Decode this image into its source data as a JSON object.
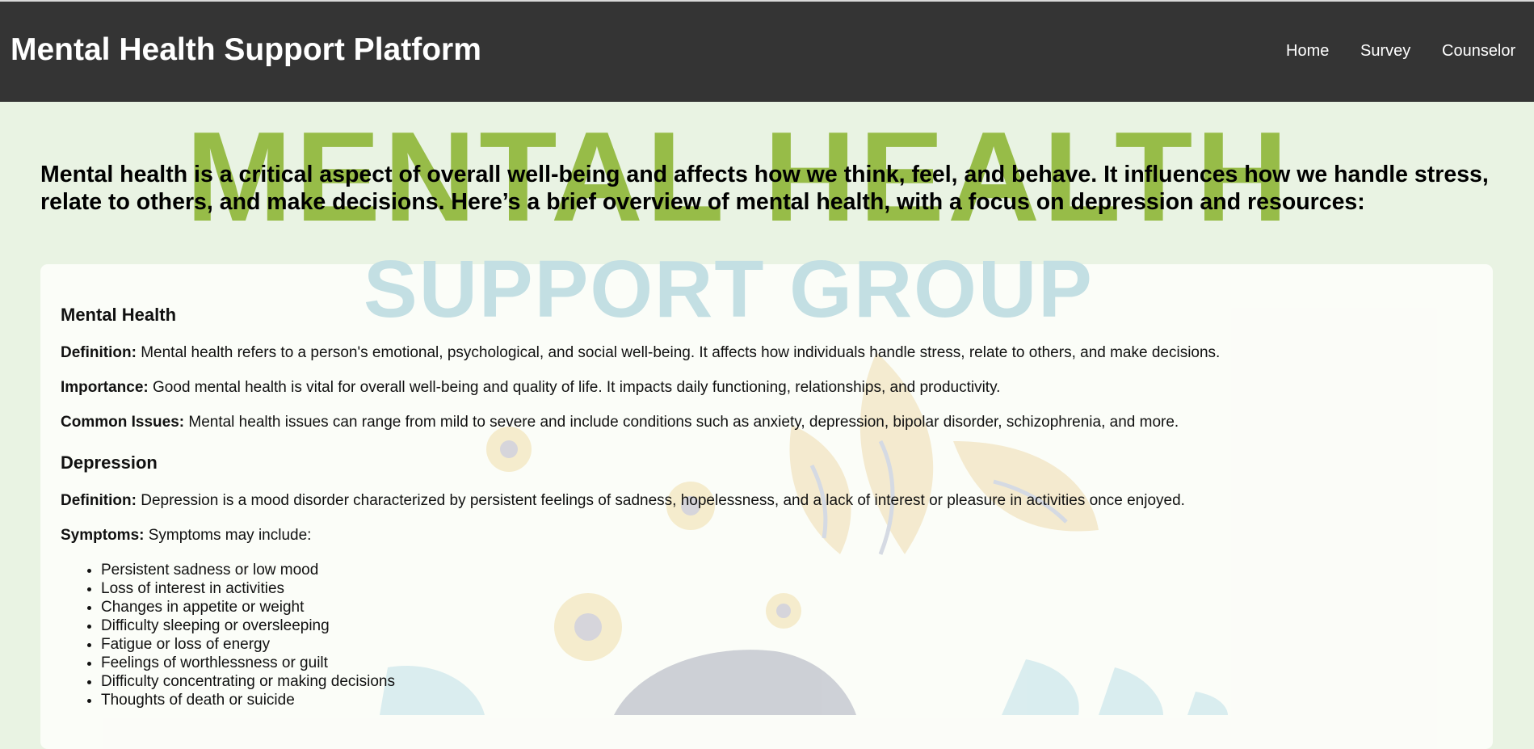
{
  "header": {
    "title": "Mental Health Support Platform",
    "nav": [
      "Home",
      "Survey",
      "Counselor"
    ]
  },
  "watermark": {
    "line1": "MENTAL HEALTH",
    "line2": "SUPPORT GROUP"
  },
  "intro": "Mental health is a critical aspect of overall well-being and affects how we think, feel, and behave. It influences how we handle stress, relate to others, and make decisions. Here’s a brief overview of mental health, with a focus on depression and resources:",
  "sections": {
    "mental_health": {
      "heading": "Mental Health",
      "definition_label": "Definition:",
      "definition": " Mental health refers to a person's emotional, psychological, and social well-being. It affects how individuals handle stress, relate to others, and make decisions.",
      "importance_label": "Importance:",
      "importance": " Good mental health is vital for overall well-being and quality of life. It impacts daily functioning, relationships, and productivity.",
      "issues_label": "Common Issues:",
      "issues": " Mental health issues can range from mild to severe and include conditions such as anxiety, depression, bipolar disorder, schizophrenia, and more."
    },
    "depression": {
      "heading": "Depression",
      "definition_label": "Definition:",
      "definition": " Depression is a mood disorder characterized by persistent feelings of sadness, hopelessness, and a lack of interest or pleasure in activities once enjoyed.",
      "symptoms_label": "Symptoms:",
      "symptoms": " Symptoms may include:",
      "symptom_list": [
        "Persistent sadness or low mood",
        "Loss of interest in activities",
        "Changes in appetite or weight",
        "Difficulty sleeping or oversleeping",
        "Fatigue or loss of energy",
        "Feelings of worthlessness or guilt",
        "Difficulty concentrating or making decisions",
        "Thoughts of death or suicide"
      ]
    }
  },
  "colors": {
    "header_bg": "#343434",
    "page_bg": "#e9f3e3",
    "card_bg": "#fcfdf9",
    "watermark_green": "#97bc48",
    "watermark_blue": "#c3dfe3",
    "flower_yellow": "#f5e6b8",
    "leaf_blue": "#cde4ea"
  }
}
